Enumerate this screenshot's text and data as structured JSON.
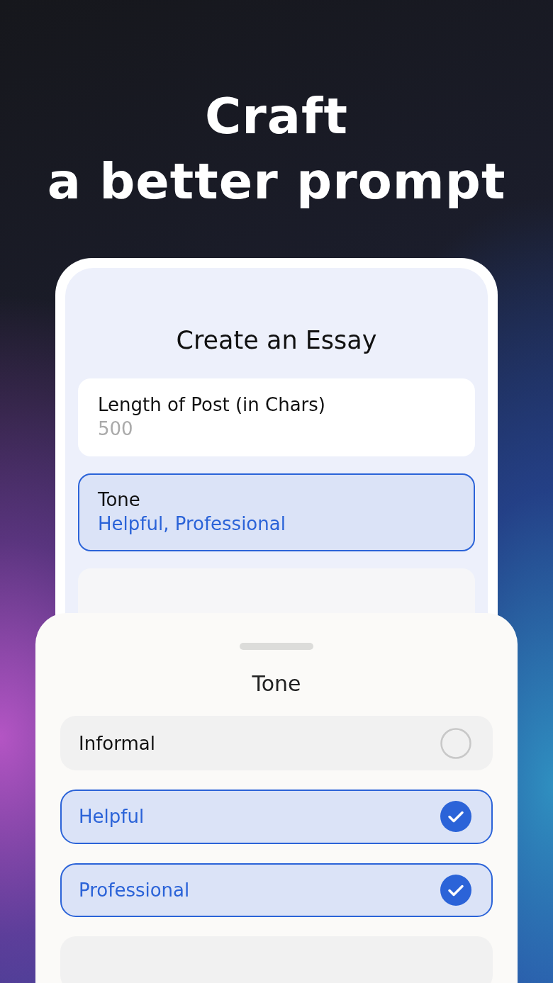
{
  "headline": [
    "Craft",
    "a better prompt"
  ],
  "form": {
    "title": "Create an Essay",
    "fields": [
      {
        "label": "Length of Post (in Chars)",
        "value": "500",
        "selected": false
      },
      {
        "label": "Tone",
        "value": "Helpful, Professional",
        "selected": true
      }
    ]
  },
  "sheet": {
    "title": "Tone",
    "options": [
      {
        "label": "Informal",
        "selected": false
      },
      {
        "label": "Helpful",
        "selected": true
      },
      {
        "label": "Professional",
        "selected": true
      }
    ]
  }
}
